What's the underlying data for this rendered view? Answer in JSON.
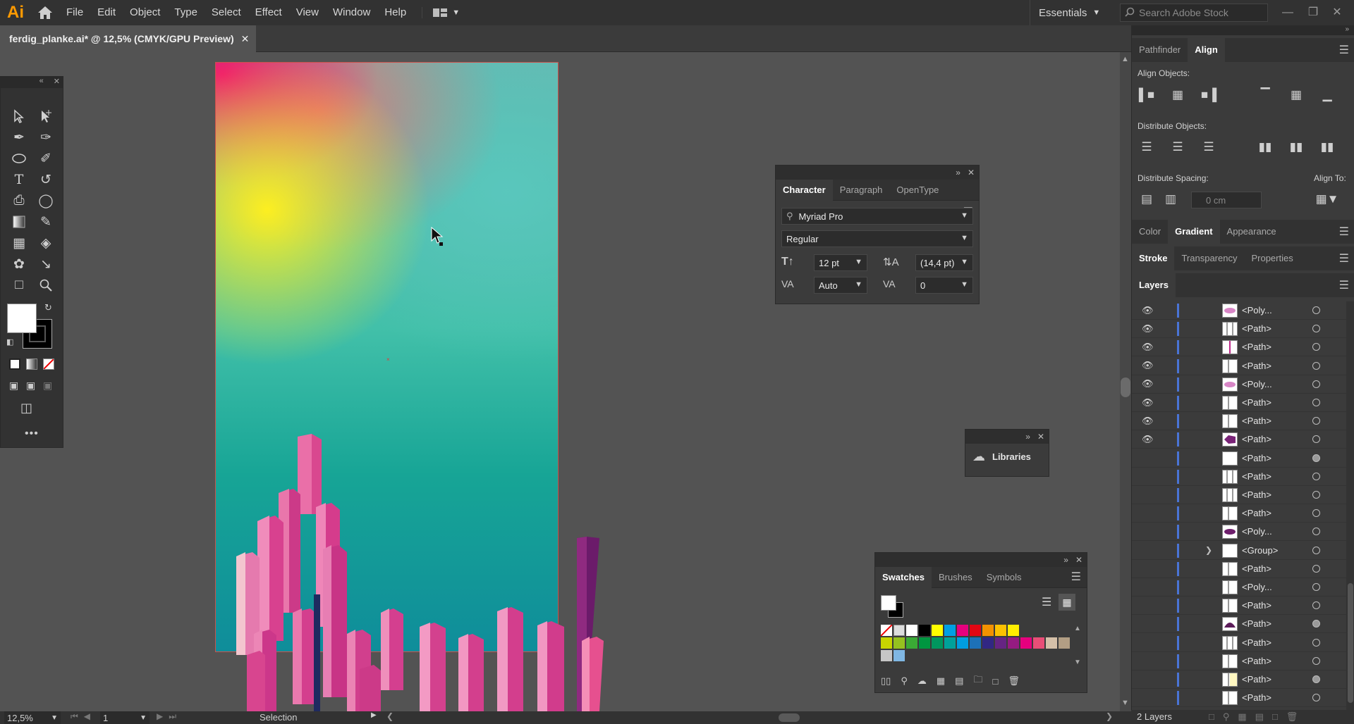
{
  "app": {
    "logo": "Ai"
  },
  "menu": [
    "File",
    "Edit",
    "Object",
    "Type",
    "Select",
    "Effect",
    "View",
    "Window",
    "Help"
  ],
  "workspace": {
    "label": "Essentials"
  },
  "stock_search": {
    "placeholder": "Search Adobe Stock"
  },
  "document": {
    "tab_title": "ferdig_planke.ai* @ 12,5% (CMYK/GPU Preview)"
  },
  "status": {
    "zoom": "12,5%",
    "artboard_number": "1",
    "tool": "Selection"
  },
  "character_panel": {
    "tabs": [
      "Character",
      "Paragraph",
      "OpenType"
    ],
    "font_family": "Myriad Pro",
    "font_style": "Regular",
    "font_size": "12 pt",
    "leading": "(14,4 pt)",
    "kerning": "Auto",
    "tracking": "0"
  },
  "libraries_panel": {
    "label": "Libraries"
  },
  "swatches_panel": {
    "tabs": [
      "Swatches",
      "Brushes",
      "Symbols"
    ]
  },
  "align_panel": {
    "tabs": [
      "Pathfinder",
      "Align"
    ],
    "align_objects": "Align Objects:",
    "distribute_objects": "Distribute Objects:",
    "distribute_spacing": "Distribute Spacing:",
    "align_to": "Align To:",
    "spacing_value": "0 cm"
  },
  "color_tabs": [
    "Color",
    "Gradient",
    "Appearance"
  ],
  "stroke_tabs": [
    "Stroke",
    "Transparency",
    "Properties"
  ],
  "layers_panel": {
    "title": "Layers",
    "footer": "2 Layers",
    "rows": [
      {
        "name": "<Poly...",
        "visible": true,
        "thumb": "pink-blob",
        "selected": false
      },
      {
        "name": "<Path>",
        "visible": true,
        "thumb": "lines",
        "selected": false
      },
      {
        "name": "<Path>",
        "visible": true,
        "thumb": "line-pink",
        "selected": false
      },
      {
        "name": "<Path>",
        "visible": true,
        "thumb": "line",
        "selected": false
      },
      {
        "name": "<Poly...",
        "visible": true,
        "thumb": "pink-blob",
        "selected": false
      },
      {
        "name": "<Path>",
        "visible": true,
        "thumb": "line",
        "selected": false
      },
      {
        "name": "<Path>",
        "visible": true,
        "thumb": "line",
        "selected": false
      },
      {
        "name": "<Path>",
        "visible": true,
        "thumb": "purple-shape",
        "selected": false
      },
      {
        "name": "<Path>",
        "visible": false,
        "thumb": "blank",
        "selected": true
      },
      {
        "name": "<Path>",
        "visible": false,
        "thumb": "lines",
        "selected": false
      },
      {
        "name": "<Path>",
        "visible": false,
        "thumb": "lines",
        "selected": false
      },
      {
        "name": "<Path>",
        "visible": false,
        "thumb": "line",
        "selected": false
      },
      {
        "name": "<Poly...",
        "visible": false,
        "thumb": "purple-blob",
        "selected": false
      },
      {
        "name": "<Group>",
        "visible": false,
        "thumb": "blank",
        "selected": false,
        "expandable": true
      },
      {
        "name": "<Path>",
        "visible": false,
        "thumb": "line",
        "selected": false
      },
      {
        "name": "<Poly...",
        "visible": false,
        "thumb": "line",
        "selected": false
      },
      {
        "name": "<Path>",
        "visible": false,
        "thumb": "line",
        "selected": false
      },
      {
        "name": "<Path>",
        "visible": false,
        "thumb": "purple-dome",
        "selected": true
      },
      {
        "name": "<Path>",
        "visible": false,
        "thumb": "lines",
        "selected": false
      },
      {
        "name": "<Path>",
        "visible": false,
        "thumb": "line",
        "selected": false
      },
      {
        "name": "<Path>",
        "visible": false,
        "thumb": "line-yellow",
        "selected": true
      },
      {
        "name": "<Path>",
        "visible": false,
        "thumb": "line",
        "selected": false
      }
    ]
  },
  "swatch_colors": [
    "#ffffff",
    "#000000",
    "#ffff00",
    "#009fe3",
    "#e6007e",
    "#e30613",
    "#f39200",
    "#fcc100",
    "#ffed00",
    "#c8d400",
    "#95c11f",
    "#3aaa35",
    "#009640",
    "#00965e",
    "#00a19a",
    "#009ee0",
    "#1d71b8",
    "#312783",
    "#662483",
    "#951b81",
    "#e6007e",
    "#e94e77",
    "#d5c0a8",
    "#b29e84",
    "#8f7c69",
    "#6b5c50",
    "#c49a6c",
    "#a17443",
    "#7f5a33",
    "#f9b000",
    "#c6c6c6",
    "#7fb7e3"
  ]
}
